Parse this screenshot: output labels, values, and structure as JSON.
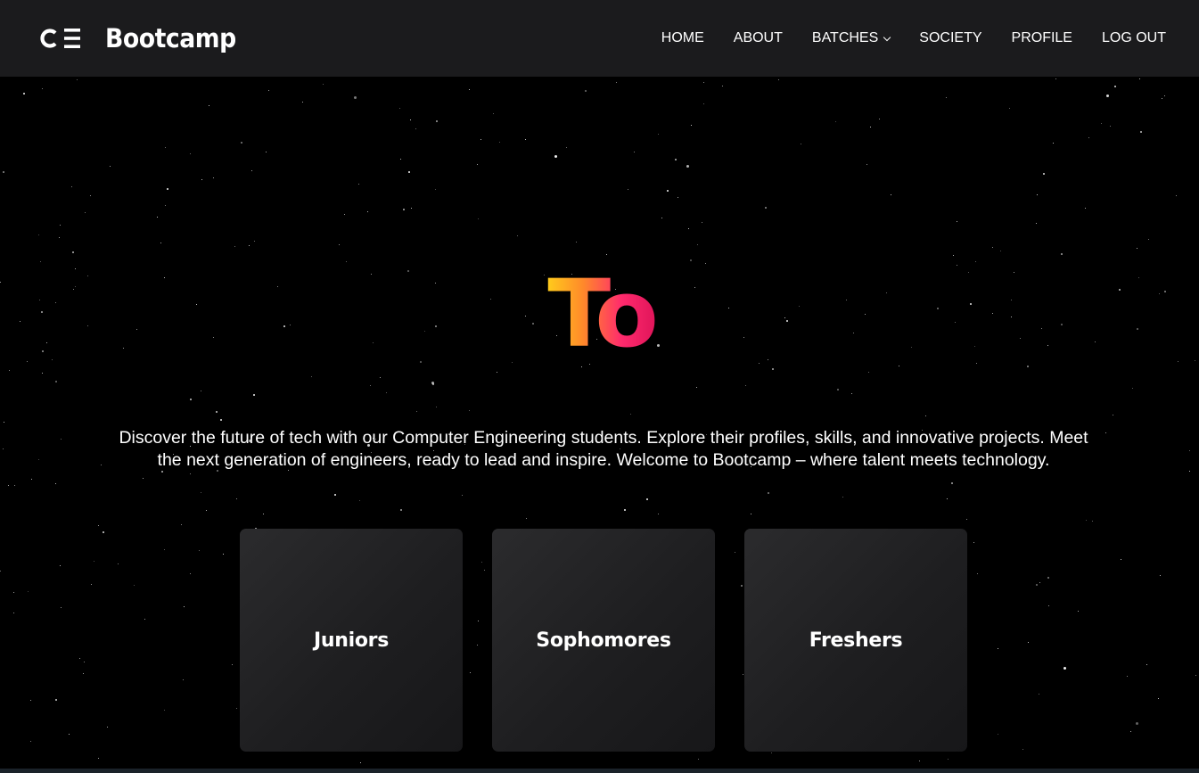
{
  "header": {
    "logo_text": "Bootcamp",
    "nav": [
      {
        "label": "HOME",
        "has_dropdown": false
      },
      {
        "label": "ABOUT",
        "has_dropdown": false
      },
      {
        "label": "BATCHES",
        "has_dropdown": true
      },
      {
        "label": "SOCIETY",
        "has_dropdown": false
      },
      {
        "label": "PROFILE",
        "has_dropdown": false
      },
      {
        "label": "LOG OUT",
        "has_dropdown": false
      }
    ]
  },
  "hero": {
    "title": "To",
    "description": "Discover the future of tech with our Computer Engineering students. Explore their profiles, skills, and innovative projects. Meet the next generation of engineers, ready to lead and inspire. Welcome to Bootcamp – where talent meets technology."
  },
  "batches": [
    {
      "label": "Juniors"
    },
    {
      "label": "Sophomores"
    },
    {
      "label": "Freshers"
    }
  ],
  "colors": {
    "header_bg": "#1b1b1d",
    "page_bg": "#000000",
    "gradient_start": "#ffd21a",
    "gradient_end": "#e0155a",
    "card_bg": "#222224"
  }
}
